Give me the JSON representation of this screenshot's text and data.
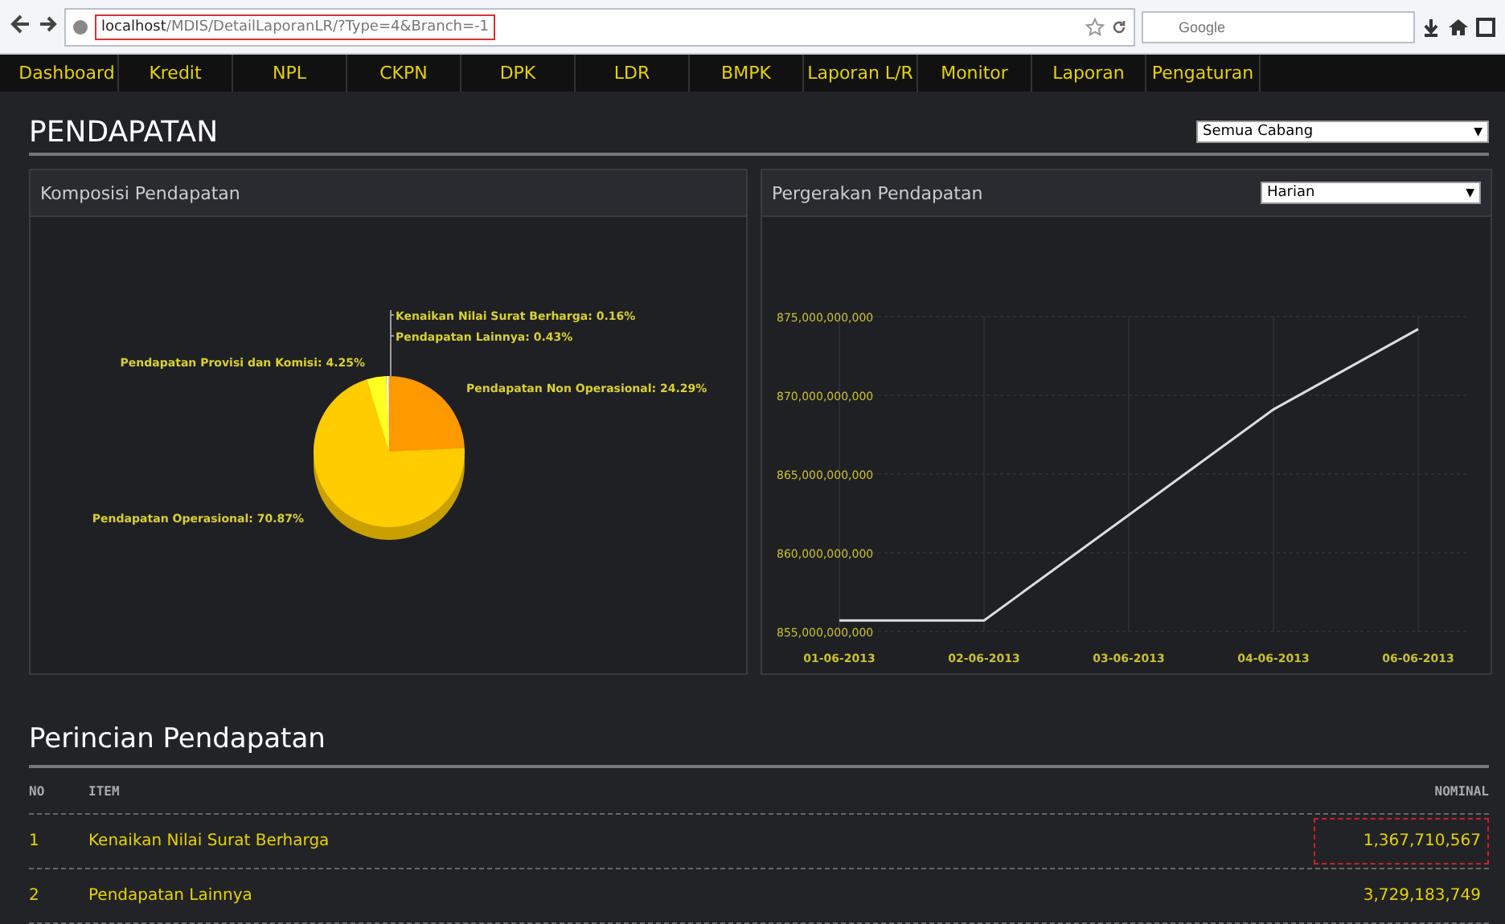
{
  "browser": {
    "url_host": "localhost",
    "url_path": "/MDIS/DetailLaporanLR/?Type=4&Branch=-1",
    "url_highlighted": true,
    "search_placeholder": "Google"
  },
  "nav": [
    {
      "label": "Dashboard",
      "selected": false
    },
    {
      "label": "Kredit",
      "selected": false
    },
    {
      "label": "NPL",
      "selected": false
    },
    {
      "label": "CKPN",
      "selected": false
    },
    {
      "label": "DPK",
      "selected": false
    },
    {
      "label": "LDR",
      "selected": false
    },
    {
      "label": "BMPK",
      "selected": false
    },
    {
      "label": "Laporan L/R",
      "selected": false
    },
    {
      "label": "Monitor",
      "selected": false
    },
    {
      "label": "Laporan",
      "selected": false
    },
    {
      "label": "Pengaturan",
      "selected": false
    }
  ],
  "page": {
    "title": "PENDAPATAN",
    "branch_select": {
      "value": "Semua Cabang",
      "caret": "▼"
    }
  },
  "composition_panel": {
    "title": "Komposisi Pendapatan",
    "chart_data": {
      "type": "pie",
      "categories": [
        "Pendapatan Non Operasional: 24.29%",
        "Pendapatan Operasional: 70.87%",
        "Pendapatan Provisi dan Komisi: 4.25%",
        "Pendapatan Lainnya: 0.43%",
        "Kenaikan Nilai Surat Berharga: 0.16%"
      ],
      "values": [
        24.29,
        70.87,
        4.25,
        0.43,
        0.16
      ]
    }
  },
  "movement_panel": {
    "title": "Pergerakan Pendapatan",
    "period_select": {
      "value": "Harian",
      "caret": "▼"
    },
    "chart_data": {
      "type": "line",
      "grid": true,
      "categories": [
        "01-06-2013",
        "02-06-2013",
        "03-06-2013",
        "04-06-2013",
        "06-06-2013"
      ],
      "series": [
        {
          "color": "#dddddd",
          "values": [
            855700000000,
            855700000000,
            862400000000,
            869100000000,
            874200000000
          ]
        }
      ],
      "ylim": [
        855000000000,
        875000000000
      ],
      "yticks": [
        {
          "value": 855000000000,
          "label": "855,000,000,000"
        },
        {
          "value": 860000000000,
          "label": "860,000,000,000"
        },
        {
          "value": 865000000000,
          "label": "865,000,000,000"
        },
        {
          "value": 870000000000,
          "label": "870,000,000,000"
        },
        {
          "value": 875000000000,
          "label": "875,000,000,000"
        }
      ]
    }
  },
  "detail": {
    "title": "Perincian Pendapatan",
    "columns": [
      "NO",
      "ITEM",
      "NOMINAL"
    ],
    "rows": [
      {
        "no": "1",
        "item": "Kenaikan Nilai Surat Berharga",
        "nominal": "1,367,710,567",
        "highlighted": true
      },
      {
        "no": "2",
        "item": "Pendapatan Lainnya",
        "nominal": "3,729,183,749",
        "highlighted": false
      }
    ]
  }
}
